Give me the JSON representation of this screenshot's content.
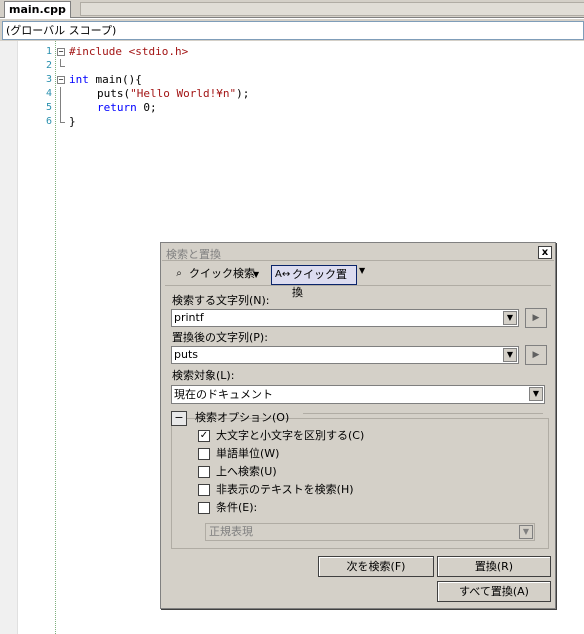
{
  "tab": {
    "label": "main.cpp"
  },
  "scope": {
    "value": "(グローバル スコープ)"
  },
  "editor": {
    "lines": [
      {
        "num": "1",
        "text": "#include <stdio.h>"
      },
      {
        "num": "2",
        "text": ""
      },
      {
        "num": "3",
        "text_kw": "int",
        "text_rest": " main(){"
      },
      {
        "num": "4",
        "text_fn": "puts(",
        "text_str": "\"Hello World!¥n\"",
        "text_end": ");"
      },
      {
        "num": "5",
        "text_kw": "return",
        "text_rest": " 0;"
      },
      {
        "num": "6",
        "text": "}"
      }
    ]
  },
  "dialog": {
    "title": "検索と置換",
    "close": "x",
    "toolbar": {
      "quick_find": "クイック検索",
      "quick_replace": "クイック置換"
    },
    "find_label": "検索する文字列(N):",
    "find_value": "printf",
    "replace_label": "置換後の文字列(P):",
    "replace_value": "puts",
    "target_label": "検索対象(L):",
    "target_value": "現在のドキュメント",
    "options_title": "検索オプション(O)",
    "options": [
      {
        "label": "大文字と小文字を区別する(C)",
        "checked": true
      },
      {
        "label": "単語単位(W)",
        "checked": false
      },
      {
        "label": "上へ検索(U)",
        "checked": false
      },
      {
        "label": "非表示のテキストを検索(H)",
        "checked": false
      },
      {
        "label": "条件(E):",
        "checked": false
      }
    ],
    "regex_value": "正規表現",
    "buttons": {
      "find_next": "次を検索(F)",
      "replace": "置換(R)",
      "replace_all": "すべて置換(A)"
    }
  },
  "colors": {
    "keyword": "#0000ff",
    "string": "#a31515",
    "line_number": "#2b91af",
    "dialog_bg": "#d4d0c8"
  }
}
